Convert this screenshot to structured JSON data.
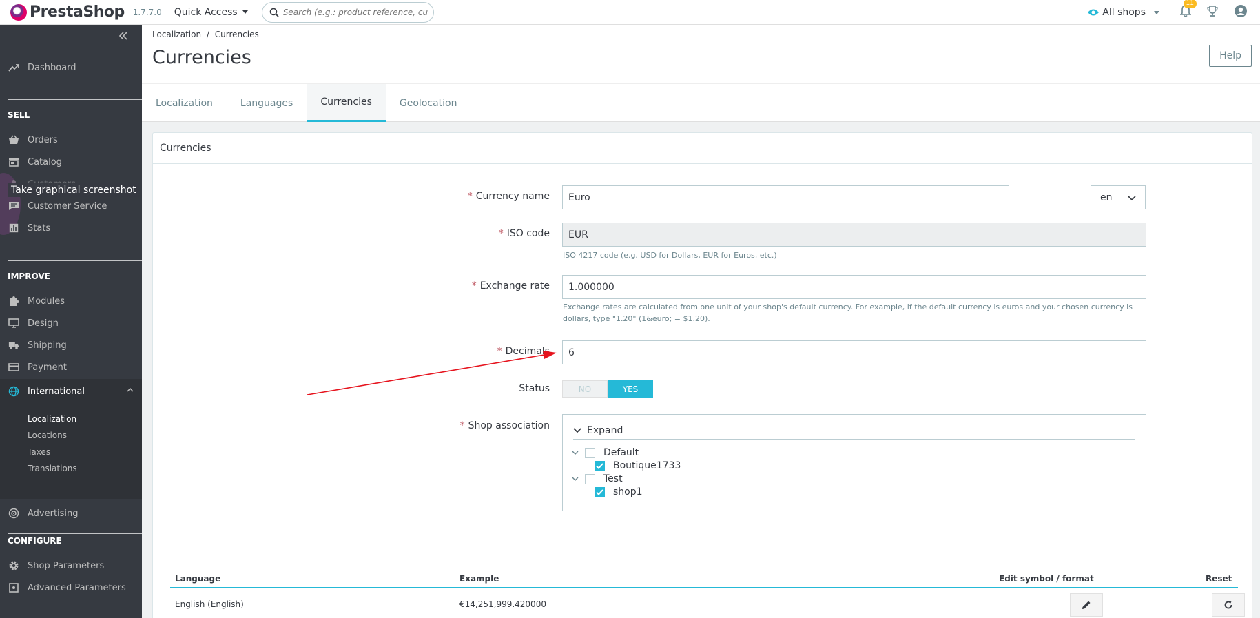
{
  "header": {
    "logo_text": "PrestaShop",
    "version": "1.7.7.0",
    "quick_access": "Quick Access",
    "search_placeholder": "Search (e.g.: product reference, custome",
    "all_shops": "All shops",
    "notification_count": "11"
  },
  "sidebar": {
    "dashboard": "Dashboard",
    "sell_title": "SELL",
    "sell_items": [
      "Orders",
      "Catalog",
      "Customers",
      "Customer Service",
      "Stats"
    ],
    "improve_title": "IMPROVE",
    "improve_items": [
      "Modules",
      "Design",
      "Shipping",
      "Payment",
      "International"
    ],
    "international_sub": [
      "Localization",
      "Locations",
      "Taxes",
      "Translations"
    ],
    "advertising": "Advertising",
    "configure_title": "CONFIGURE",
    "configure_items": [
      "Shop Parameters",
      "Advanced Parameters"
    ],
    "tooltip": "Take graphical screenshot"
  },
  "page": {
    "breadcrumb": [
      "Localization",
      "Currencies"
    ],
    "breadcrumb_sep": "/",
    "title": "Currencies",
    "help_label": "Help",
    "tabs": [
      "Localization",
      "Languages",
      "Currencies",
      "Geolocation"
    ]
  },
  "form": {
    "panel_title": "Currencies",
    "required_mark": "*",
    "currency_name_label": "Currency name",
    "currency_name_value": "Euro",
    "language_value": "en",
    "iso_label": "ISO code",
    "iso_value": "EUR",
    "iso_help": "ISO 4217 code (e.g. USD for Dollars, EUR for Euros, etc.)",
    "rate_label": "Exchange rate",
    "rate_value": "1.000000",
    "rate_help_1": "Exchange rates are calculated from one unit of your shop's default currency. For example, if the default currency is euros and your chosen currency is",
    "rate_help_2": "dollars, type \"1.20\" (1&euro; = $1.20).",
    "decimals_label": "Decimals",
    "decimals_value": "6",
    "status_label": "Status",
    "status_no": "NO",
    "status_yes": "YES",
    "shop_assoc_label": "Shop association",
    "expand_label": "Expand",
    "shop_groups": [
      {
        "name": "Default",
        "shop": "Boutique1733"
      },
      {
        "name": "Test",
        "shop": "shop1"
      }
    ]
  },
  "table": {
    "headers": [
      "Language",
      "Example",
      "Edit symbol / format",
      "Reset"
    ],
    "rows": [
      {
        "language": "English (English)",
        "example": "€14,251,999.420000"
      }
    ]
  },
  "colors": {
    "accent": "#25b9d7",
    "sidebar_bg": "#363a41",
    "required": "#c05c67",
    "annotation_arrow": "#e6141e"
  }
}
